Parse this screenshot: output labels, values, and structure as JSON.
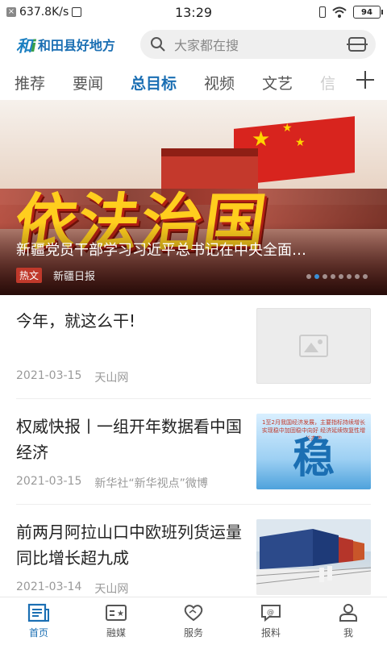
{
  "status_bar": {
    "speed": "637.8K/s",
    "time": "13:29",
    "battery": "94"
  },
  "header": {
    "logo_text": "和田县好地方",
    "search_placeholder": "大家都在搜"
  },
  "tabs": [
    "推荐",
    "要闻",
    "总目标",
    "视频",
    "文艺",
    "信"
  ],
  "active_tab": "总目标",
  "banner": {
    "image_text": "依法治国",
    "caption": "新疆党员干部学习习近平总书记在中央全面…",
    "tag": "热文",
    "source": "新疆日报",
    "slide_count": 8,
    "active_slide": 1
  },
  "news": [
    {
      "title": "今年，就这么干!",
      "date": "2021-03-15",
      "source": "天山网",
      "thumb": "image-placeholder-icon"
    },
    {
      "title": "权威快报丨一组开年数据看中国经济",
      "date": "2021-03-15",
      "source": "新华社“新华视点”微博",
      "thumb": "stability-chart",
      "thumb_text_top": "1至2月我国经济发展，主要指标持续增长 实现稳中加固稳中向好 经济延续恢复性增长态势",
      "thumb_text_big": "稳"
    },
    {
      "title": "前两月阿拉山口中欧班列货运量同比增长超九成",
      "date": "2021-03-14",
      "source": "天山网",
      "thumb": "freight-train-photo"
    }
  ],
  "bottom_nav": [
    {
      "label": "首页",
      "icon": "home-news-icon",
      "active": true
    },
    {
      "label": "融媒",
      "icon": "media-card-icon",
      "active": false
    },
    {
      "label": "服务",
      "icon": "service-heart-icon",
      "active": false
    },
    {
      "label": "报料",
      "icon": "report-chat-icon",
      "active": false
    },
    {
      "label": "我",
      "icon": "user-icon",
      "active": false
    }
  ],
  "colors": {
    "accent": "#1b6fb3",
    "hot_tag": "#c0392b"
  }
}
